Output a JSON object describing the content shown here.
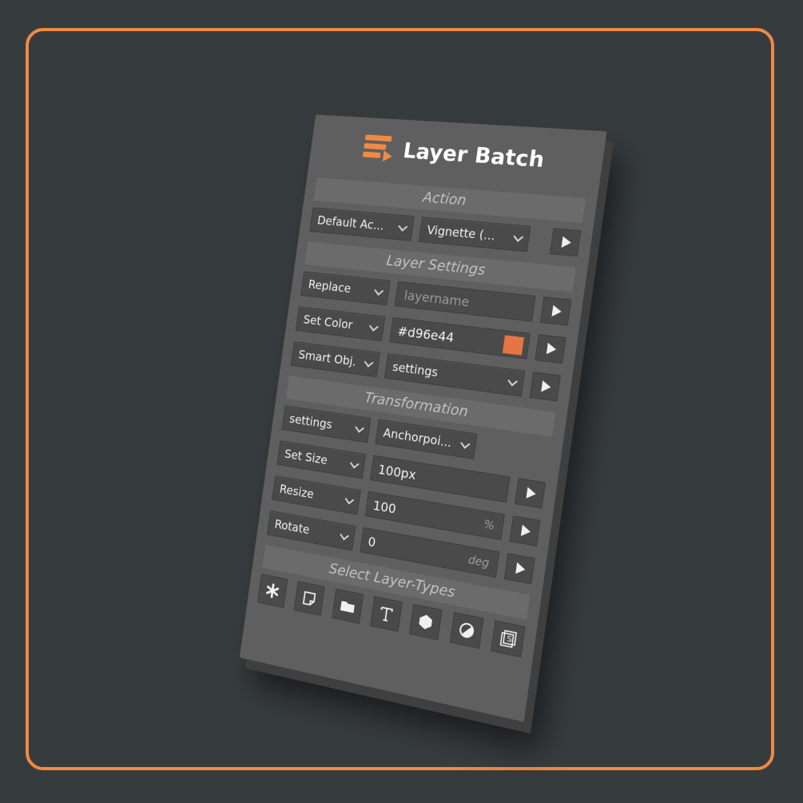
{
  "app": {
    "title": "Layer Batch",
    "accent": "#ef8a45"
  },
  "sections": {
    "action": "Action",
    "layer_settings": "Layer Settings",
    "transformation": "Transformation",
    "select_types": "Select Layer-Types"
  },
  "action_row": {
    "set": "Default Ac...",
    "action": "Vignette (..."
  },
  "replace_row": {
    "mode": "Replace",
    "placeholder": "layername"
  },
  "color_row": {
    "mode": "Set Color",
    "value": "#d96e44",
    "swatch": "#e57544"
  },
  "smart_row": {
    "mode": "Smart Obj.",
    "option": "settings"
  },
  "transform_row": {
    "mode": "settings",
    "anchor": "Anchorpoi..."
  },
  "size_row": {
    "mode": "Set Size",
    "value": "100px"
  },
  "resize_row": {
    "mode": "Resize",
    "value": "100",
    "unit": "%"
  },
  "rotate_row": {
    "mode": "Rotate",
    "value": "0",
    "unit": "deg"
  },
  "layer_types": [
    {
      "name": "all-types",
      "icon": "asterisk-icon"
    },
    {
      "name": "pixel-layer",
      "icon": "layer-icon"
    },
    {
      "name": "group",
      "icon": "folder-icon"
    },
    {
      "name": "text",
      "icon": "text-icon"
    },
    {
      "name": "shape",
      "icon": "shape-icon"
    },
    {
      "name": "adjustment",
      "icon": "adjustment-icon"
    },
    {
      "name": "smart-object",
      "icon": "smart-object-icon"
    }
  ]
}
